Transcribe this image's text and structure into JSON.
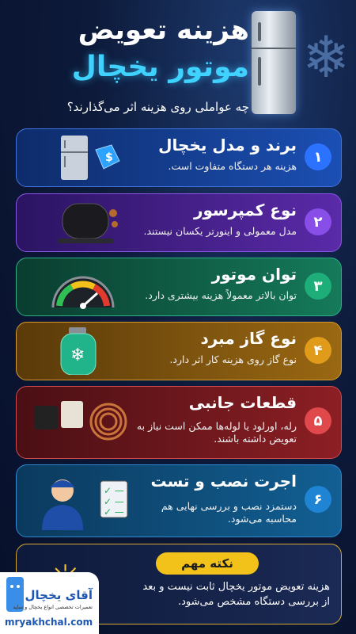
{
  "header": {
    "title_line1": "هزینه تعویض",
    "title_line2": "موتور یخچال",
    "subtitle": "چه عواملی روی هزینه اثر می‌گذارند؟"
  },
  "cards": [
    {
      "num": "۱",
      "title": "برند و مدل یخچال",
      "desc": "هزینه هر دستگاه متفاوت است.",
      "icon": "fridge-price-tag-icon"
    },
    {
      "num": "۲",
      "title": "نوع کمپرسور",
      "desc": "مدل معمولی و اینورتر یکسان نیستند.",
      "icon": "compressor-icon"
    },
    {
      "num": "۳",
      "title": "توان موتور",
      "desc": "توان بالاتر معمولاً هزینه بیشتری دارد.",
      "icon": "gauge-icon"
    },
    {
      "num": "۴",
      "title": "نوع گاز مبرد",
      "desc": "نوع گاز روی هزینه کار اثر دارد.",
      "icon": "gas-cylinder-icon"
    },
    {
      "num": "۵",
      "title": "قطعات جانبی",
      "desc": "رله، اورلود یا لوله‌ها ممکن است نیاز به تعویض داشته باشند.",
      "icon": "relay-parts-icon"
    },
    {
      "num": "۶",
      "title": "اجرت نصب و تست",
      "desc": "دستمزد نصب و بررسی نهایی هم محاسبه می‌شود.",
      "icon": "technician-icon"
    }
  ],
  "note": {
    "badge": "نکته مهم",
    "text": "هزینه تعویض موتور یخچال ثابت نیست و بعد از بررسی دستگاه مشخص می‌شود."
  },
  "logo": {
    "brand": "آقای یخچال",
    "tagline": "تعمیرات تخصصی انواع یخچال و ساید",
    "url": "mryakhchal.com"
  }
}
